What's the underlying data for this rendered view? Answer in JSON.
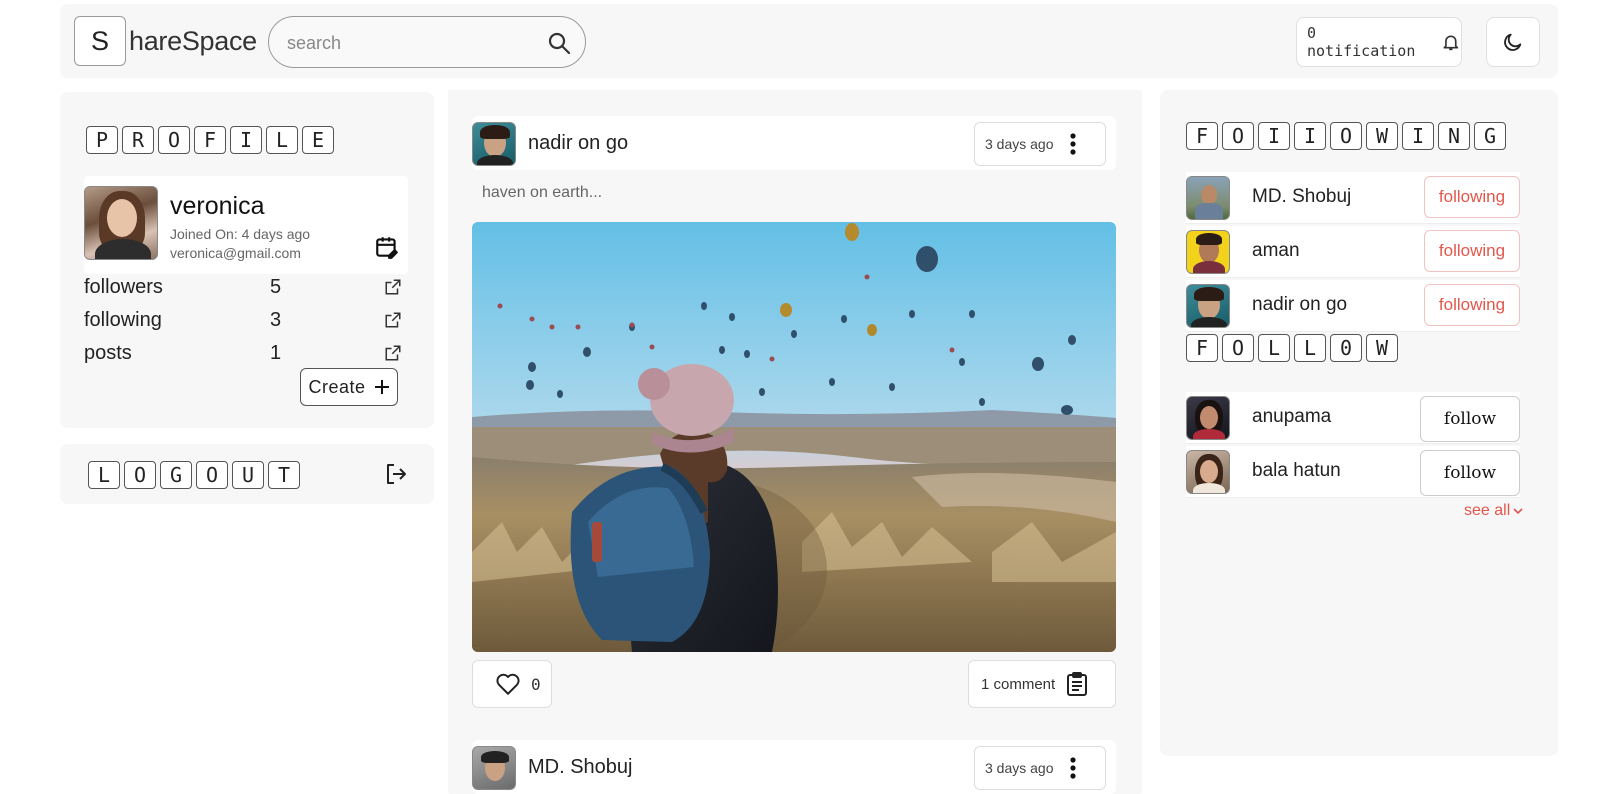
{
  "header": {
    "logo_letter": "S",
    "logo_text": "hareSpace",
    "search_placeholder": "search",
    "notification_label": "0 notification"
  },
  "profile": {
    "heading_letters": [
      "P",
      "R",
      "O",
      "F",
      "I",
      "L",
      "E"
    ],
    "name": "veronica",
    "joined": "Joined On: 4 days ago",
    "email": "veronica@gmail.com",
    "stats": [
      {
        "label": "followers",
        "value": "5"
      },
      {
        "label": "following",
        "value": "3"
      },
      {
        "label": "posts",
        "value": "1"
      }
    ],
    "create_label": "Create"
  },
  "logout": {
    "letters": [
      "L",
      "O",
      "G",
      "O",
      "U",
      "T"
    ]
  },
  "feed": {
    "posts": [
      {
        "author": "nadir on go",
        "time": "3 days ago",
        "caption": "haven on earth...",
        "likes": "0",
        "comments": "1 comment"
      },
      {
        "author": "MD. Shobuj",
        "time": "3 days ago"
      }
    ]
  },
  "sidebar": {
    "following_letters": [
      "F",
      "O",
      "I",
      "I",
      "O",
      "W",
      "I",
      "N",
      "G"
    ],
    "following": [
      {
        "name": "MD. Shobuj",
        "button": "following"
      },
      {
        "name": "aman",
        "button": "following"
      },
      {
        "name": "nadir on go",
        "button": "following"
      }
    ],
    "follow_letters": [
      "F",
      "O",
      "L",
      "L",
      "0",
      "W"
    ],
    "suggestions": [
      {
        "name": "anupama",
        "button": "follow"
      },
      {
        "name": "bala hatun",
        "button": "follow"
      }
    ],
    "see_all": "see all"
  },
  "colors": {
    "accent": "#e2574c",
    "panel_bg": "#f7f7f7"
  }
}
